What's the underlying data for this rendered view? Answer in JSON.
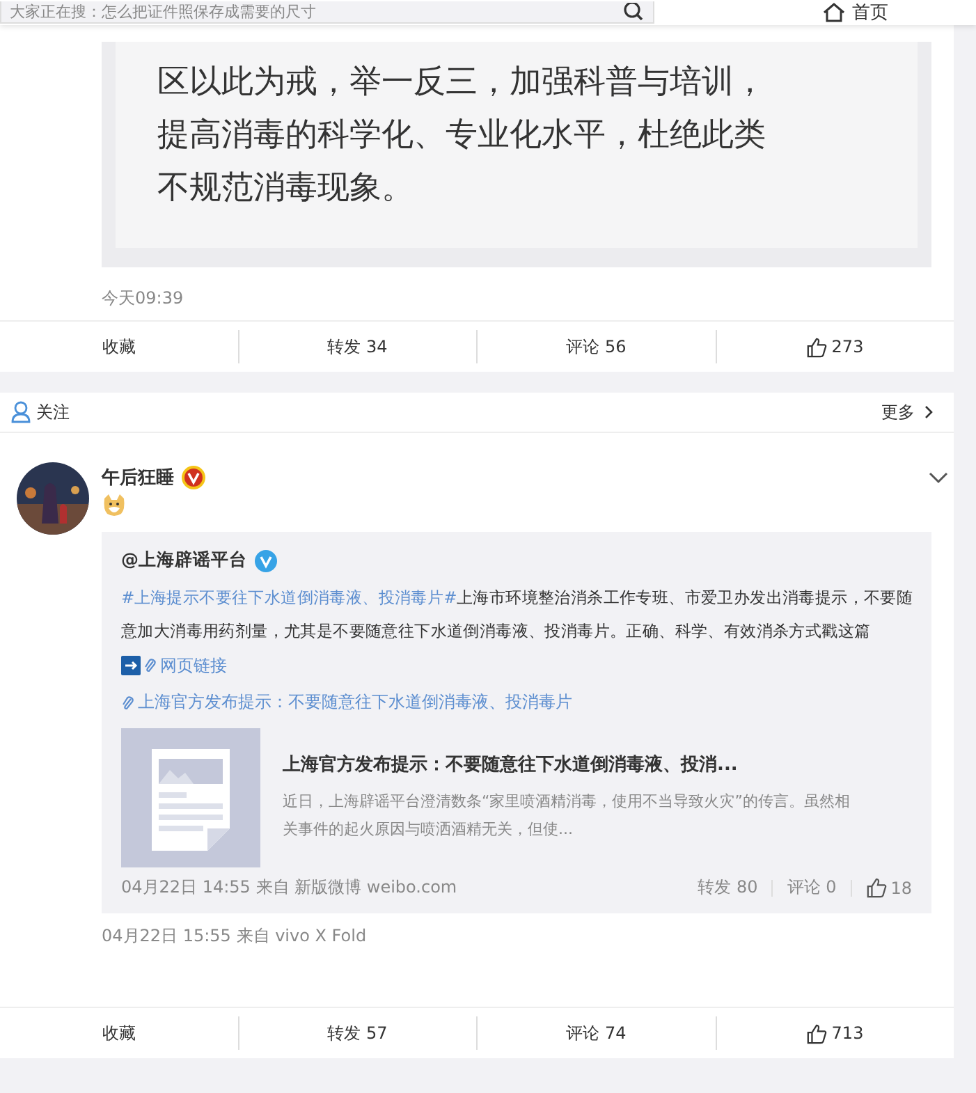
{
  "top_bar": {
    "search": {
      "value": "大家正在搜：怎么把证件照保存成需要的尺寸"
    },
    "nav": [
      {
        "label": "首页",
        "kind": "home"
      }
    ]
  },
  "post_1": {
    "image_lines": [
      "区以此为戒，举一反三，加强科普与培训，",
      "提高消毒的科学化、专业化水平，杜绝此类",
      "不规范消毒现象。"
    ],
    "time": "今天09:39",
    "actions": [
      {
        "kind": "fav",
        "label": "收藏"
      },
      {
        "kind": "repost",
        "label": "转发 34"
      },
      {
        "kind": "comment",
        "label": "评论 56"
      },
      {
        "kind": "like",
        "label": "273"
      }
    ]
  },
  "post_2": {
    "header": {
      "label": "关注",
      "more": "更多"
    },
    "author": {
      "name": "午后狂睡",
      "verified": true
    },
    "repost": {
      "author": "@上海辟谣平台",
      "verified": true,
      "text_parts": [
        {
          "kind": "link",
          "text": "#上海提示不要往下水道倒消毒液、投消毒片#"
        },
        {
          "kind": "text",
          "text": "上海市环境整治消杀工作专班、市爱卫办发出消毒提示，不要随意加大消毒用药剂量，尤其是不要随意往下水道倒消毒液、投消毒片。正确、科学、有效消杀方式戳这篇"
        }
      ],
      "web_link": "网页链接",
      "attachment_link": "上海官方发布提示：不要随意往下水道倒消毒液、投消毒片",
      "card": {
        "title": "上海官方发布提示：不要随意往下水道倒消毒液、投消...",
        "summary": "近日，上海辟谣平台澄清数条“家里喷酒精消毒，使用不当导致火灾”的传言。虽然相关事件的起火原因与喷洒酒精无关，但使..."
      },
      "meta": "04月22日 14:55 来自 新版微博 weibo.com",
      "actions": [
        {
          "kind": "repost",
          "label": "转发 80"
        },
        {
          "kind": "comment",
          "label": "评论 0"
        },
        {
          "kind": "like",
          "label": "18"
        }
      ]
    },
    "meta": "04月22日 15:55  来自 vivo X Fold",
    "actions": [
      {
        "kind": "fav",
        "label": "收藏"
      },
      {
        "kind": "repost",
        "label": "转发 57"
      },
      {
        "kind": "comment",
        "label": "评论 74"
      },
      {
        "kind": "like",
        "label": "713"
      }
    ]
  }
}
